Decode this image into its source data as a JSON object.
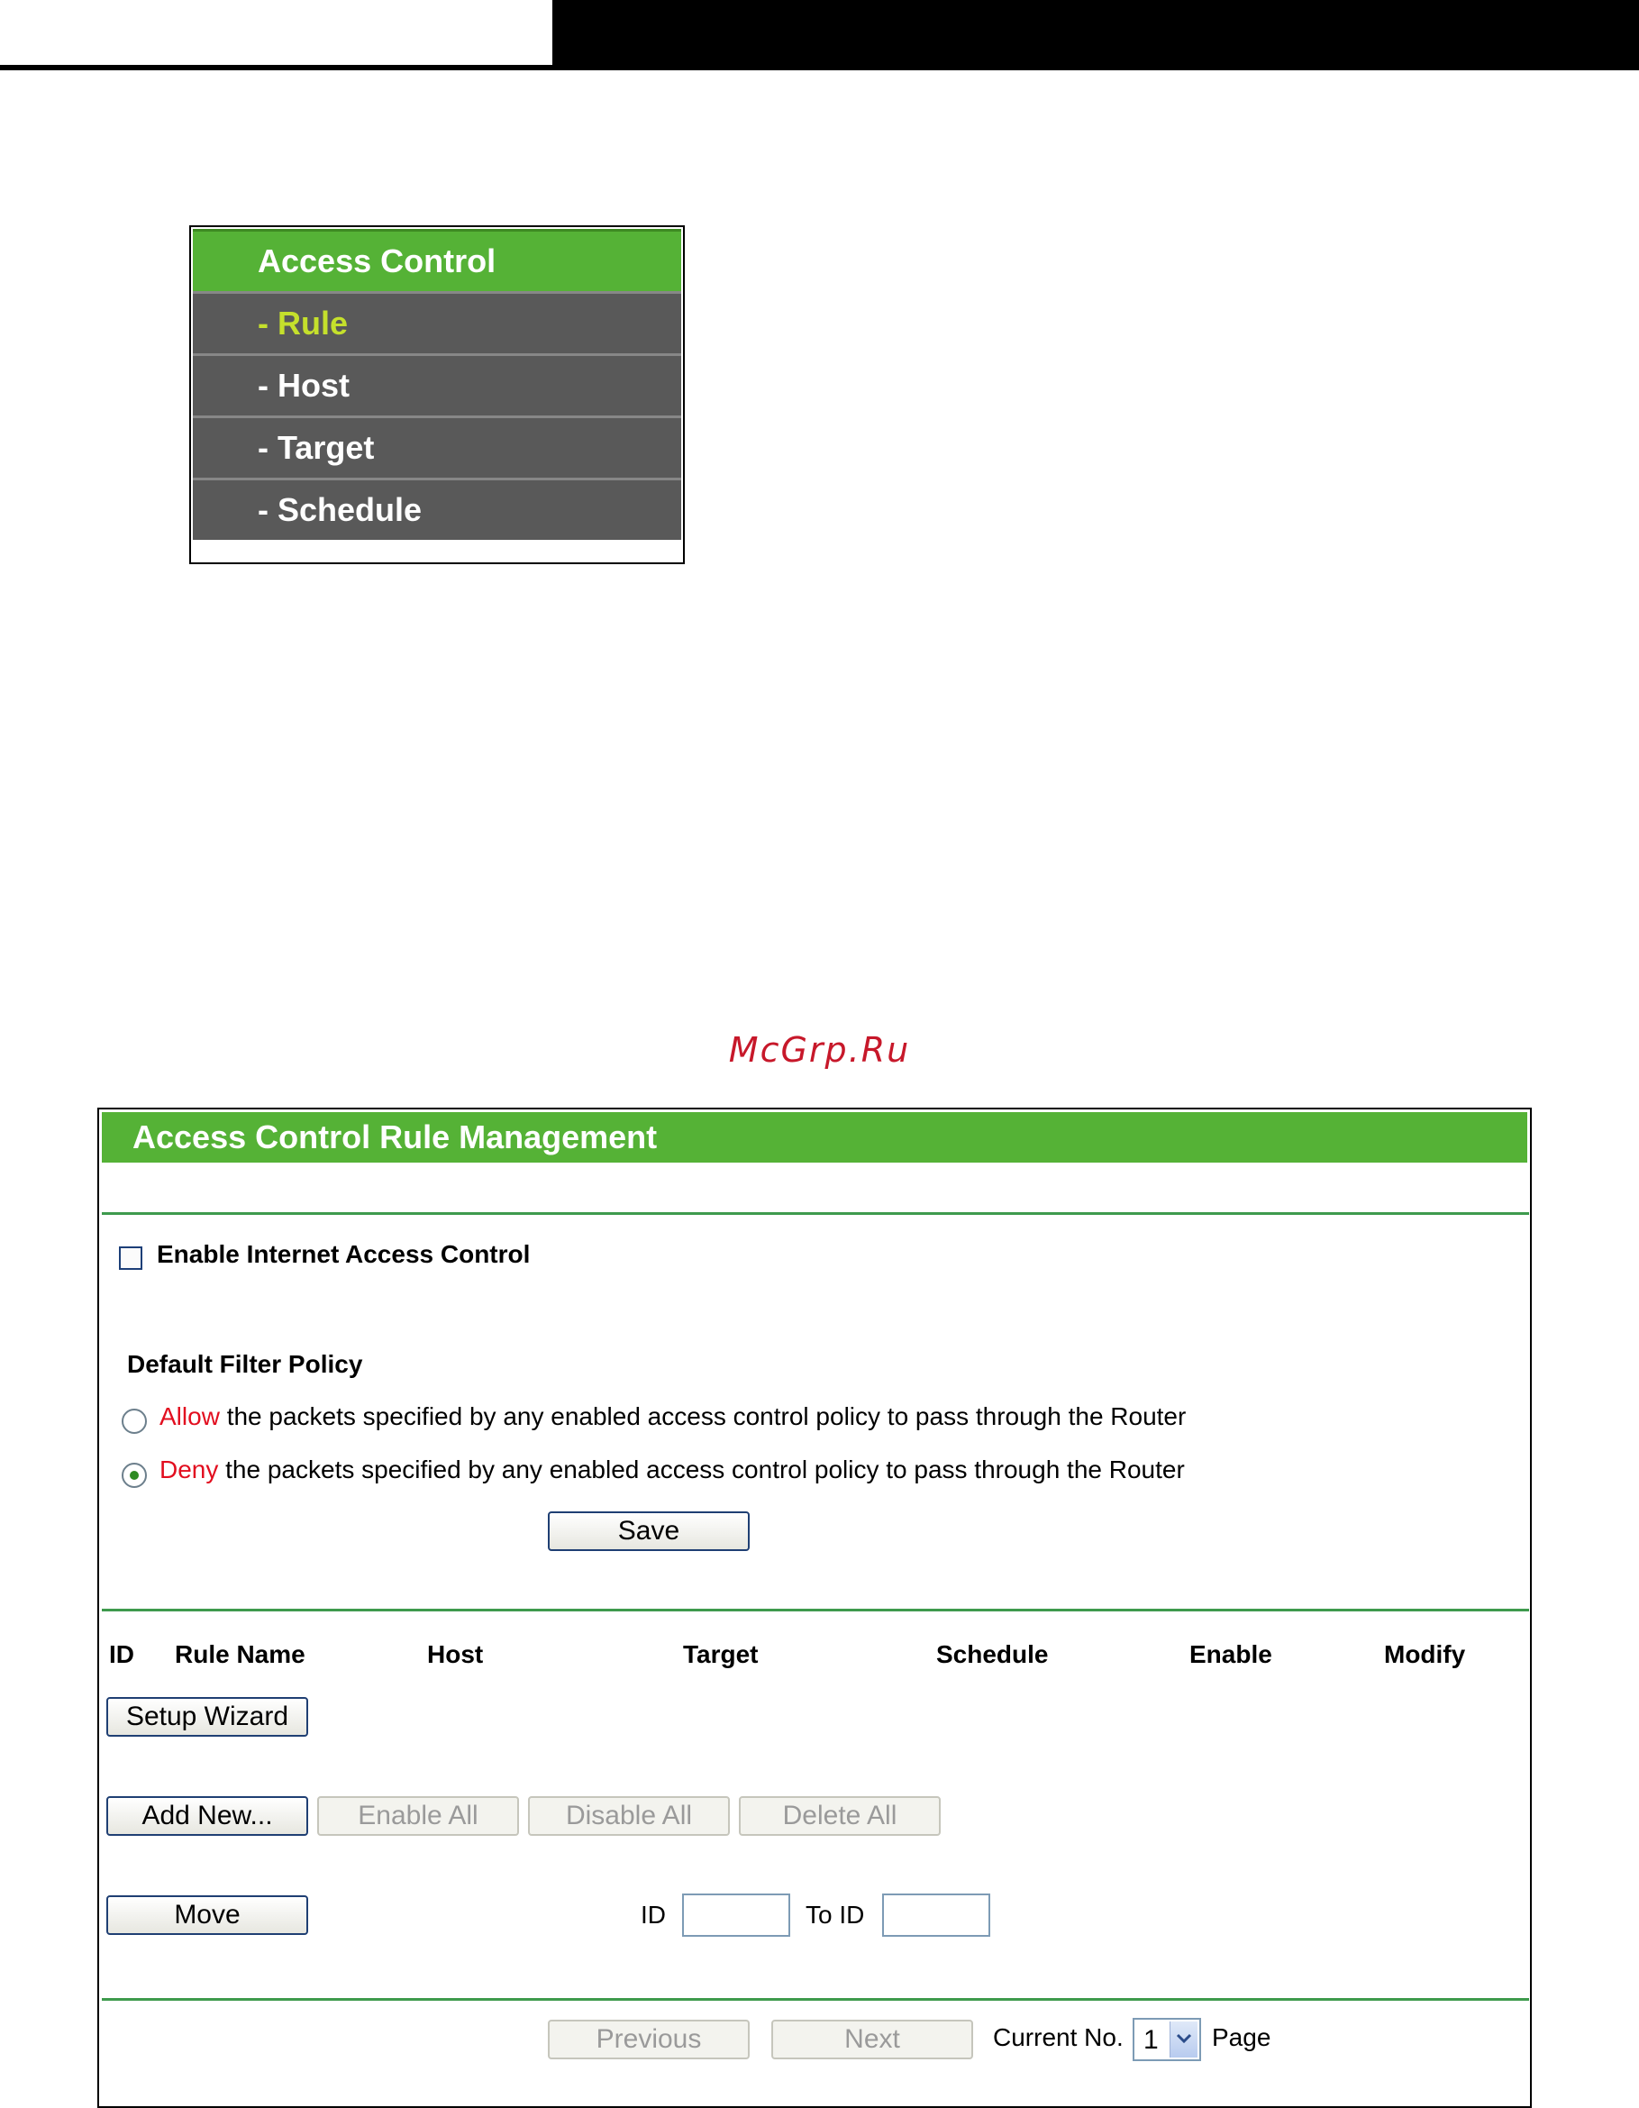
{
  "menu": {
    "title": "Access Control",
    "items": [
      {
        "label": "- Rule",
        "active": true
      },
      {
        "label": "- Host",
        "active": false
      },
      {
        "label": "- Target",
        "active": false
      },
      {
        "label": "- Schedule",
        "active": false
      }
    ]
  },
  "watermark": "McGrp.Ru",
  "panel": {
    "title": "Access Control Rule Management",
    "enable_label": "Enable Internet Access Control",
    "enable_checked": false,
    "policy_heading": "Default Filter Policy",
    "policy_options": [
      {
        "keyword": "Allow",
        "text": "the packets specified by any enabled access control policy to pass through the Router",
        "checked": false
      },
      {
        "keyword": "Deny",
        "text": "the packets specified by any enabled access control policy to pass through the Router",
        "checked": true
      }
    ],
    "save_label": "Save",
    "table_headers": {
      "id": "ID",
      "rule_name": "Rule Name",
      "host": "Host",
      "target": "Target",
      "schedule": "Schedule",
      "enable": "Enable",
      "modify": "Modify"
    },
    "buttons": {
      "setup_wizard": "Setup Wizard",
      "add_new": "Add New...",
      "enable_all": "Enable All",
      "disable_all": "Disable All",
      "delete_all": "Delete All",
      "move": "Move"
    },
    "move": {
      "id_label": "ID",
      "to_id_label": "To ID",
      "id_value": "",
      "to_id_value": ""
    },
    "pager": {
      "previous": "Previous",
      "next": "Next",
      "current_label": "Current No.",
      "current_value": "1",
      "page_label": "Page"
    }
  },
  "colors": {
    "green": "#55b236",
    "menu_gray": "#595959",
    "active_item": "#c5e02c",
    "policy_red": "#e20e1f",
    "watermark": "#c7182a"
  }
}
